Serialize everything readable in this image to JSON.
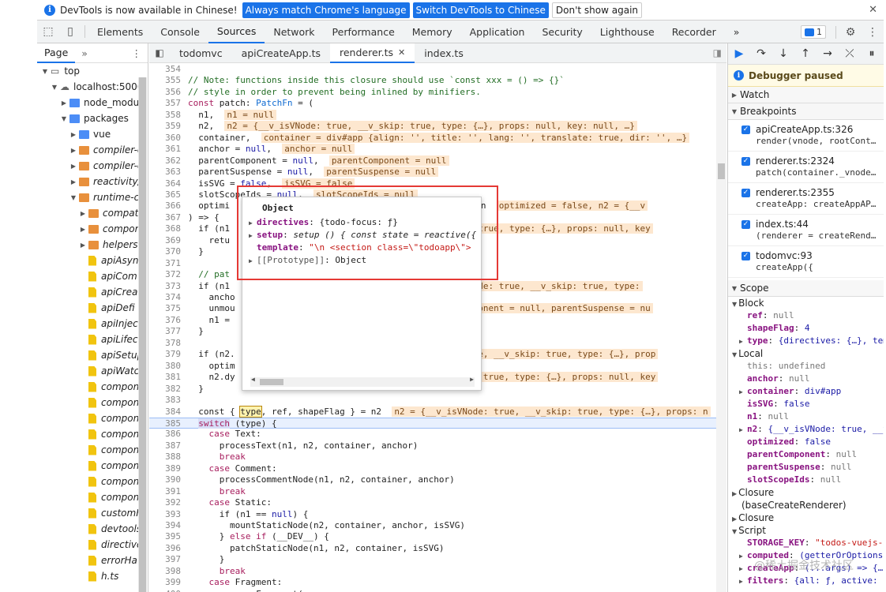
{
  "infobar": {
    "message": "DevTools is now available in Chinese!",
    "btn_match": "Always match Chrome's language",
    "btn_switch": "Switch DevTools to Chinese",
    "btn_dont": "Don't show again",
    "close": "✕"
  },
  "toolbar": {
    "tabs": [
      "Elements",
      "Console",
      "Sources",
      "Network",
      "Performance",
      "Memory",
      "Application",
      "Security",
      "Lighthouse",
      "Recorder"
    ],
    "active_tab": "Sources",
    "more": "»",
    "issues_count": "1"
  },
  "navigator": {
    "tab": "Page",
    "more": "»",
    "items": [
      {
        "indent": 0,
        "arrow": "▼",
        "icon": "frame",
        "label": "top"
      },
      {
        "indent": 1,
        "arrow": "▼",
        "icon": "cloud",
        "label": "localhost:5000"
      },
      {
        "indent": 2,
        "arrow": "▶",
        "icon": "folder-blue",
        "label": "node_modul"
      },
      {
        "indent": 2,
        "arrow": "▼",
        "icon": "folder-blue",
        "label": "packages"
      },
      {
        "indent": 3,
        "arrow": "▶",
        "icon": "folder-blue",
        "label": "vue"
      },
      {
        "indent": 3,
        "arrow": "▶",
        "icon": "folder-orange",
        "label": "compiler-c",
        "italic": true
      },
      {
        "indent": 3,
        "arrow": "▶",
        "icon": "folder-orange",
        "label": "compiler-c",
        "italic": true
      },
      {
        "indent": 3,
        "arrow": "▶",
        "icon": "folder-orange",
        "label": "reactivity/",
        "italic": true
      },
      {
        "indent": 3,
        "arrow": "▼",
        "icon": "folder-orange",
        "label": "runtime-c",
        "italic": true
      },
      {
        "indent": 4,
        "arrow": "▶",
        "icon": "folder-orange",
        "label": "compat",
        "italic": true
      },
      {
        "indent": 4,
        "arrow": "▶",
        "icon": "folder-orange",
        "label": "compon",
        "italic": true
      },
      {
        "indent": 4,
        "arrow": "▶",
        "icon": "folder-orange",
        "label": "helpers",
        "italic": true
      },
      {
        "indent": 4,
        "arrow": "",
        "icon": "file",
        "label": "apiAsyn",
        "italic": true
      },
      {
        "indent": 4,
        "arrow": "",
        "icon": "file",
        "label": "apiCom",
        "italic": true
      },
      {
        "indent": 4,
        "arrow": "",
        "icon": "file",
        "label": "apiCrea",
        "italic": true
      },
      {
        "indent": 4,
        "arrow": "",
        "icon": "file",
        "label": "apiDefi",
        "italic": true
      },
      {
        "indent": 4,
        "arrow": "",
        "icon": "file",
        "label": "apiInjec",
        "italic": true
      },
      {
        "indent": 4,
        "arrow": "",
        "icon": "file",
        "label": "apiLifec",
        "italic": true
      },
      {
        "indent": 4,
        "arrow": "",
        "icon": "file",
        "label": "apiSetup",
        "italic": true
      },
      {
        "indent": 4,
        "arrow": "",
        "icon": "file",
        "label": "apiWatc",
        "italic": true
      },
      {
        "indent": 4,
        "arrow": "",
        "icon": "file",
        "label": "compon",
        "italic": true
      },
      {
        "indent": 4,
        "arrow": "",
        "icon": "file",
        "label": "compon",
        "italic": true
      },
      {
        "indent": 4,
        "arrow": "",
        "icon": "file",
        "label": "compon",
        "italic": true
      },
      {
        "indent": 4,
        "arrow": "",
        "icon": "file",
        "label": "compon",
        "italic": true
      },
      {
        "indent": 4,
        "arrow": "",
        "icon": "file",
        "label": "compon",
        "italic": true
      },
      {
        "indent": 4,
        "arrow": "",
        "icon": "file",
        "label": "compon",
        "italic": true
      },
      {
        "indent": 4,
        "arrow": "",
        "icon": "file",
        "label": "compon",
        "italic": true
      },
      {
        "indent": 4,
        "arrow": "",
        "icon": "file",
        "label": "compon",
        "italic": true
      },
      {
        "indent": 4,
        "arrow": "",
        "icon": "file",
        "label": "customF",
        "italic": true
      },
      {
        "indent": 4,
        "arrow": "",
        "icon": "file",
        "label": "devtools",
        "italic": true
      },
      {
        "indent": 4,
        "arrow": "",
        "icon": "file",
        "label": "directive",
        "italic": true
      },
      {
        "indent": 4,
        "arrow": "",
        "icon": "file",
        "label": "errorHa",
        "italic": true
      },
      {
        "indent": 4,
        "arrow": "",
        "icon": "file",
        "label": "h.ts",
        "italic": true
      }
    ]
  },
  "editor": {
    "tabs": [
      {
        "label": "todomvc"
      },
      {
        "label": "apiCreateApp.ts"
      },
      {
        "label": "renderer.ts",
        "active": true,
        "close": "✕"
      },
      {
        "label": "index.ts"
      }
    ]
  },
  "code_lines": [
    {
      "n": "354",
      "segs": [
        {
          "t": ""
        }
      ]
    },
    {
      "n": "355",
      "segs": [
        {
          "t": "// Note: functions inside this closure should use `const xxx = () => {}`",
          "c": "cm"
        }
      ]
    },
    {
      "n": "356",
      "segs": [
        {
          "t": "// style in order to prevent being inlined by minifiers.",
          "c": "cm"
        }
      ]
    },
    {
      "n": "357",
      "segs": [
        {
          "t": "const ",
          "c": "kw"
        },
        {
          "t": "patch: "
        },
        {
          "t": "PatchFn",
          "c": "ty"
        },
        {
          "t": " = ("
        }
      ]
    },
    {
      "n": "358",
      "segs": [
        {
          "t": "  n1,  "
        },
        {
          "t": "n1 = null",
          "c": "inl"
        }
      ]
    },
    {
      "n": "359",
      "segs": [
        {
          "t": "  n2,  "
        },
        {
          "t": "n2 = {__v_isVNode: true, __v_skip: true, type: {…}, props: null, key: null, …}",
          "c": "inl"
        }
      ]
    },
    {
      "n": "360",
      "segs": [
        {
          "t": "  container,  "
        },
        {
          "t": "container = div#app {align: '', title: '', lang: '', translate: true, dir: '', …}",
          "c": "inl"
        }
      ]
    },
    {
      "n": "361",
      "segs": [
        {
          "t": "  anchor = "
        },
        {
          "t": "null",
          "c": "kb"
        },
        {
          "t": ",  "
        },
        {
          "t": "anchor = null",
          "c": "inl"
        }
      ]
    },
    {
      "n": "362",
      "segs": [
        {
          "t": "  parentComponent = "
        },
        {
          "t": "null",
          "c": "kb"
        },
        {
          "t": ",  "
        },
        {
          "t": "parentComponent = null",
          "c": "inl"
        }
      ]
    },
    {
      "n": "363",
      "segs": [
        {
          "t": "  parentSuspense = "
        },
        {
          "t": "null",
          "c": "kb"
        },
        {
          "t": ",  "
        },
        {
          "t": "parentSuspense = null",
          "c": "inl"
        }
      ]
    },
    {
      "n": "364",
      "segs": [
        {
          "t": "  isSVG = "
        },
        {
          "t": "false",
          "c": "kb"
        },
        {
          "t": ",  "
        },
        {
          "t": "isSVG = false",
          "c": "inl"
        }
      ]
    },
    {
      "n": "365",
      "segs": [
        {
          "t": "  slotScopeIds = "
        },
        {
          "t": "null",
          "c": "kb"
        },
        {
          "t": ",  "
        },
        {
          "t": "slotScopeIds = null",
          "c": "inl"
        }
      ]
    },
    {
      "n": "366",
      "segs": [
        {
          "t": "  optimi                                  dynamicChildren  "
        },
        {
          "t": "optimized = false, n2 = {__v",
          "c": "inl"
        }
      ]
    },
    {
      "n": "367",
      "segs": [
        {
          "t": ") => {"
        }
      ]
    },
    {
      "n": "368",
      "segs": [
        {
          "t": "  if (n1                                   "
        },
        {
          "t": ", __v_skip: true, type: {…}, props: null, key",
          "c": "inl"
        }
      ]
    },
    {
      "n": "369",
      "segs": [
        {
          "t": "    retu"
        }
      ]
    },
    {
      "n": "370",
      "segs": [
        {
          "t": "  }"
        }
      ]
    },
    {
      "n": "371",
      "segs": [
        {
          "t": ""
        }
      ]
    },
    {
      "n": "372",
      "segs": [
        {
          "t": "  // pat",
          "c": "cm"
        }
      ]
    },
    {
      "n": "373",
      "segs": [
        {
          "t": "  if (n1                                   "
        },
        {
          "t": "= {__v_isVNode: true, __v_skip: true, type:",
          "c": "inl"
        }
      ]
    },
    {
      "n": "374",
      "segs": [
        {
          "t": "    ancho"
        }
      ]
    },
    {
      "n": "375",
      "segs": [
        {
          "t": "    unmou                                    "
        },
        {
          "t": "parentComponent = null, parentSuspense = nu",
          "c": "inl"
        }
      ]
    },
    {
      "n": "376",
      "segs": [
        {
          "t": "    n1 ="
        }
      ]
    },
    {
      "n": "377",
      "segs": [
        {
          "t": "  }"
        }
      ]
    },
    {
      "n": "378",
      "segs": [
        {
          "t": ""
        }
      ]
    },
    {
      "n": "379",
      "segs": [
        {
          "t": "  if (n2.                                  "
        },
        {
          "t": "isVNode: true, __v_skip: true, type: {…}, prop",
          "c": "inl"
        }
      ]
    },
    {
      "n": "380",
      "segs": [
        {
          "t": "    optim"
        }
      ]
    },
    {
      "n": "381",
      "segs": [
        {
          "t": "    n2.dy                                   "
        },
        {
          "t": ", __v_skip: true, type: {…}, props: null, key",
          "c": "inl"
        }
      ]
    },
    {
      "n": "382",
      "segs": [
        {
          "t": "  }"
        }
      ]
    },
    {
      "n": "383",
      "segs": [
        {
          "t": ""
        }
      ]
    },
    {
      "n": "384",
      "segs": [
        {
          "t": "  const { "
        },
        {
          "t": "type",
          "c": "sel"
        },
        {
          "t": ", ref, shapeFlag } = n2  "
        },
        {
          "t": "n2 = {__v_isVNode: true, __v_skip: true, type: {…}, props: n",
          "c": "inl"
        }
      ]
    },
    {
      "n": "385",
      "segs": [
        {
          "t": "  "
        },
        {
          "t": "switch",
          "c": "sw"
        },
        {
          "t": " (type) {"
        }
      ]
    },
    {
      "n": "386",
      "segs": [
        {
          "t": "    "
        },
        {
          "t": "case ",
          "c": "kw"
        },
        {
          "t": "Text:"
        }
      ]
    },
    {
      "n": "387",
      "segs": [
        {
          "t": "      processText(n1, n2, container, anchor)"
        }
      ]
    },
    {
      "n": "388",
      "segs": [
        {
          "t": "      "
        },
        {
          "t": "break",
          "c": "kw"
        }
      ]
    },
    {
      "n": "389",
      "segs": [
        {
          "t": "    "
        },
        {
          "t": "case ",
          "c": "kw"
        },
        {
          "t": "Comment:"
        }
      ]
    },
    {
      "n": "390",
      "segs": [
        {
          "t": "      processCommentNode(n1, n2, container, anchor)"
        }
      ]
    },
    {
      "n": "391",
      "segs": [
        {
          "t": "      "
        },
        {
          "t": "break",
          "c": "kw"
        }
      ]
    },
    {
      "n": "392",
      "segs": [
        {
          "t": "    "
        },
        {
          "t": "case ",
          "c": "kw"
        },
        {
          "t": "Static:"
        }
      ]
    },
    {
      "n": "393",
      "segs": [
        {
          "t": "      if (n1 == "
        },
        {
          "t": "null",
          "c": "kb"
        },
        {
          "t": ") {"
        }
      ]
    },
    {
      "n": "394",
      "segs": [
        {
          "t": "        mountStaticNode(n2, container, anchor, isSVG)"
        }
      ]
    },
    {
      "n": "395",
      "segs": [
        {
          "t": "      } "
        },
        {
          "t": "else if",
          "c": "kw"
        },
        {
          "t": " (__DEV__) {"
        }
      ]
    },
    {
      "n": "396",
      "segs": [
        {
          "t": "        patchStaticNode(n1, n2, container, isSVG)"
        }
      ]
    },
    {
      "n": "397",
      "segs": [
        {
          "t": "      }"
        }
      ]
    },
    {
      "n": "398",
      "segs": [
        {
          "t": "      "
        },
        {
          "t": "break",
          "c": "kw"
        }
      ]
    },
    {
      "n": "399",
      "segs": [
        {
          "t": "    "
        },
        {
          "t": "case ",
          "c": "kw"
        },
        {
          "t": "Fragment:"
        }
      ]
    },
    {
      "n": "400",
      "segs": [
        {
          "t": "      processFragment("
        }
      ]
    }
  ],
  "popup": {
    "title": "Object",
    "rows": [
      {
        "arrow": "▶",
        "key": "directives",
        "val": "{todo-focus: ƒ}"
      },
      {
        "arrow": "▶",
        "key": "setup",
        "val": "setup () { const state = reactive({"
      },
      {
        "arrow": "",
        "key": "template",
        "val": "\"\\n  <section class=\\\"todoapp\\\">"
      },
      {
        "arrow": "▶",
        "key": "[[Prototype]]",
        "val": "Object"
      }
    ]
  },
  "debugger": {
    "paused": "Debugger paused",
    "watch": "Watch",
    "breakpoints_title": "Breakpoints",
    "breakpoints": [
      {
        "file": "apiCreateApp.ts:326",
        "code": "render(vnode, rootCont…"
      },
      {
        "file": "renderer.ts:2324",
        "code": "patch(container._vnode…"
      },
      {
        "file": "renderer.ts:2355",
        "code": "createApp: createAppAP…"
      },
      {
        "file": "index.ts:44",
        "code": "(renderer = createRend…"
      },
      {
        "file": "todomvc:93",
        "code": "createApp({"
      }
    ],
    "scope_title": "Scope",
    "block_title": "Block",
    "block": [
      {
        "k": "ref",
        "v": "null"
      },
      {
        "k": "shapeFlag",
        "v": "4"
      },
      {
        "k": "type",
        "v": "{directives: {…}, tem",
        "arrow": "▶"
      }
    ],
    "local_title": "Local",
    "local": [
      {
        "k": "this",
        "v": "undefined",
        "dim": true
      },
      {
        "k": "anchor",
        "v": "null"
      },
      {
        "k": "container",
        "v": "div#app",
        "arrow": "▶"
      },
      {
        "k": "isSVG",
        "v": "false"
      },
      {
        "k": "n1",
        "v": "null"
      },
      {
        "k": "n2",
        "v": "{__v_isVNode: true, __v",
        "arrow": "▶"
      },
      {
        "k": "optimized",
        "v": "false"
      },
      {
        "k": "parentComponent",
        "v": "null"
      },
      {
        "k": "parentSuspense",
        "v": "null"
      },
      {
        "k": "slotScopeIds",
        "v": "null"
      }
    ],
    "closure1_line1": "Closure",
    "closure1_line2": "(baseCreateRenderer)",
    "closure2": "Closure",
    "script_title": "Script",
    "script": [
      {
        "k": "STORAGE_KEY",
        "v": "\"todos-vuejs-3"
      },
      {
        "k": "computed",
        "v": "(getterOrOptions,",
        "arrow": "▶"
      },
      {
        "k": "createApp",
        "v": "(...args) => {…}",
        "arrow": "▶"
      },
      {
        "k": "filters",
        "v": "{all: ƒ, active:",
        "arrow": "▶"
      }
    ]
  },
  "watermark": "@稀土掘金技术社区"
}
